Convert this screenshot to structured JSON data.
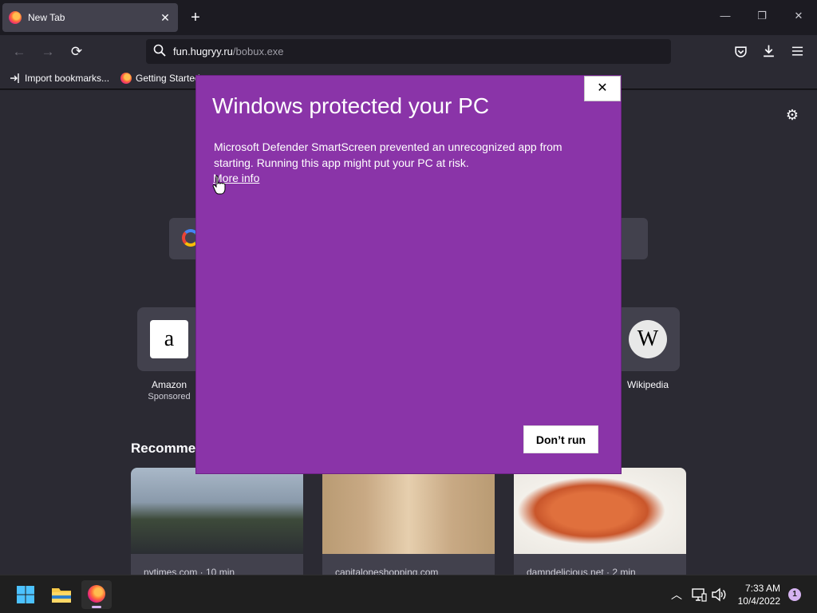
{
  "browser": {
    "tab": {
      "title": "New Tab",
      "close_glyph": "✕"
    },
    "new_tab_glyph": "+",
    "window_controls": {
      "minimize": "—",
      "restore": "❐",
      "close": "✕"
    },
    "nav": {
      "back": "←",
      "forward": "→",
      "reload": "⟳"
    },
    "url": {
      "host": "fun.hugryy.ru",
      "path": "/bobux.exe"
    },
    "toolbar_icons": [
      "pocket-icon",
      "download-icon",
      "menu-icon"
    ],
    "bookmarks": [
      {
        "label": "Import bookmarks...",
        "icon": "import-icon"
      },
      {
        "label": "Getting Started",
        "icon": "firefox-icon"
      }
    ]
  },
  "newtab_page": {
    "settings_glyph": "⚙",
    "top_sites": [
      {
        "label": "Amazon",
        "sublabel": "Sponsored",
        "glyph": "a"
      },
      {
        "label": "Wikipedia",
        "sublabel": "",
        "glyph": "W"
      }
    ],
    "recommended_heading": "Recommended by Pocket",
    "stories": [
      {
        "source": "nytimes.com · 10 min"
      },
      {
        "source": "capitaloneshopping.com"
      },
      {
        "source": "damndelicious.net · 2 min"
      }
    ]
  },
  "dialog": {
    "title": "Windows protected your PC",
    "body": "Microsoft Defender SmartScreen prevented an unrecognized app from starting. Running this app might put your PC at risk.",
    "more_info": "More info",
    "dont_run": "Don’t run",
    "close_glyph": "✕"
  },
  "taskbar": {
    "time": "7:33 AM",
    "date": "10/4/2022",
    "notification_count": "1",
    "tray": {
      "chevron": "︿",
      "network": "▭",
      "volume": "🔊"
    }
  },
  "colors": {
    "dialog_bg": "#8a34a8",
    "browser_bg": "#2b2a33",
    "taskbar_bg": "#1f1f1f"
  }
}
